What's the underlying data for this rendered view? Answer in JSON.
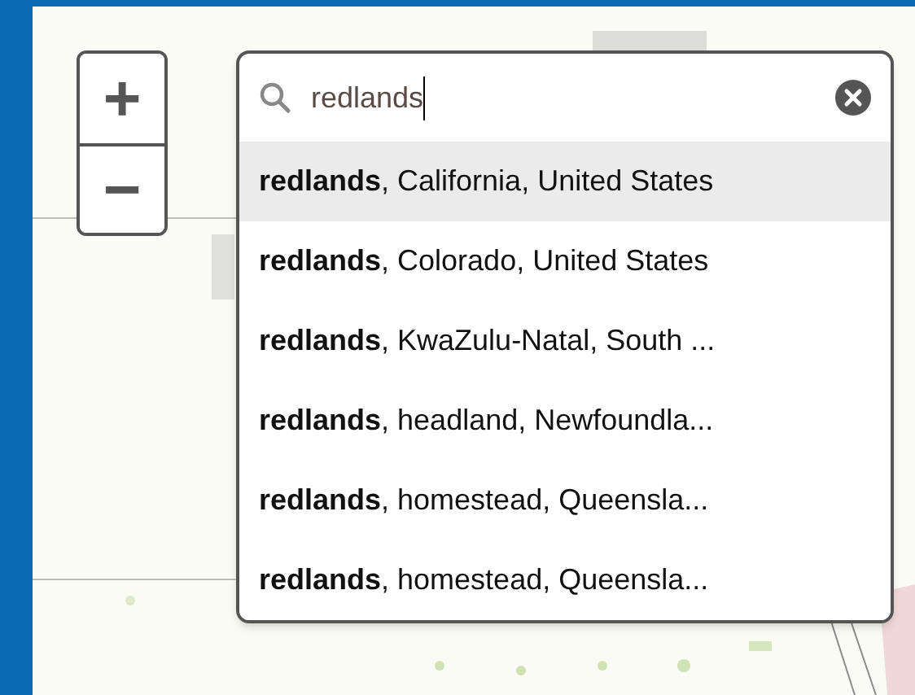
{
  "zoom_controls": [
    {
      "label": "+"
    },
    {
      "label": "−"
    }
  ],
  "search": {
    "value": "redlands"
  },
  "suggestions": [
    {
      "text": "**redlands**, California, United States",
      "selected": true
    },
    {
      "text": "**redlands**, Colorado, United States",
      "selected": false
    },
    {
      "text": "**redlands**, KwaZulu-Natal, South ...",
      "selected": false
    },
    {
      "text": "**redlands**, headland, Newfoundla...",
      "selected": false
    },
    {
      "text": "**redlands**, homestead, Queensla...",
      "selected": false
    },
    {
      "text": "**redlands**, homestead, Queensla...",
      "selected": false
    }
  ]
}
